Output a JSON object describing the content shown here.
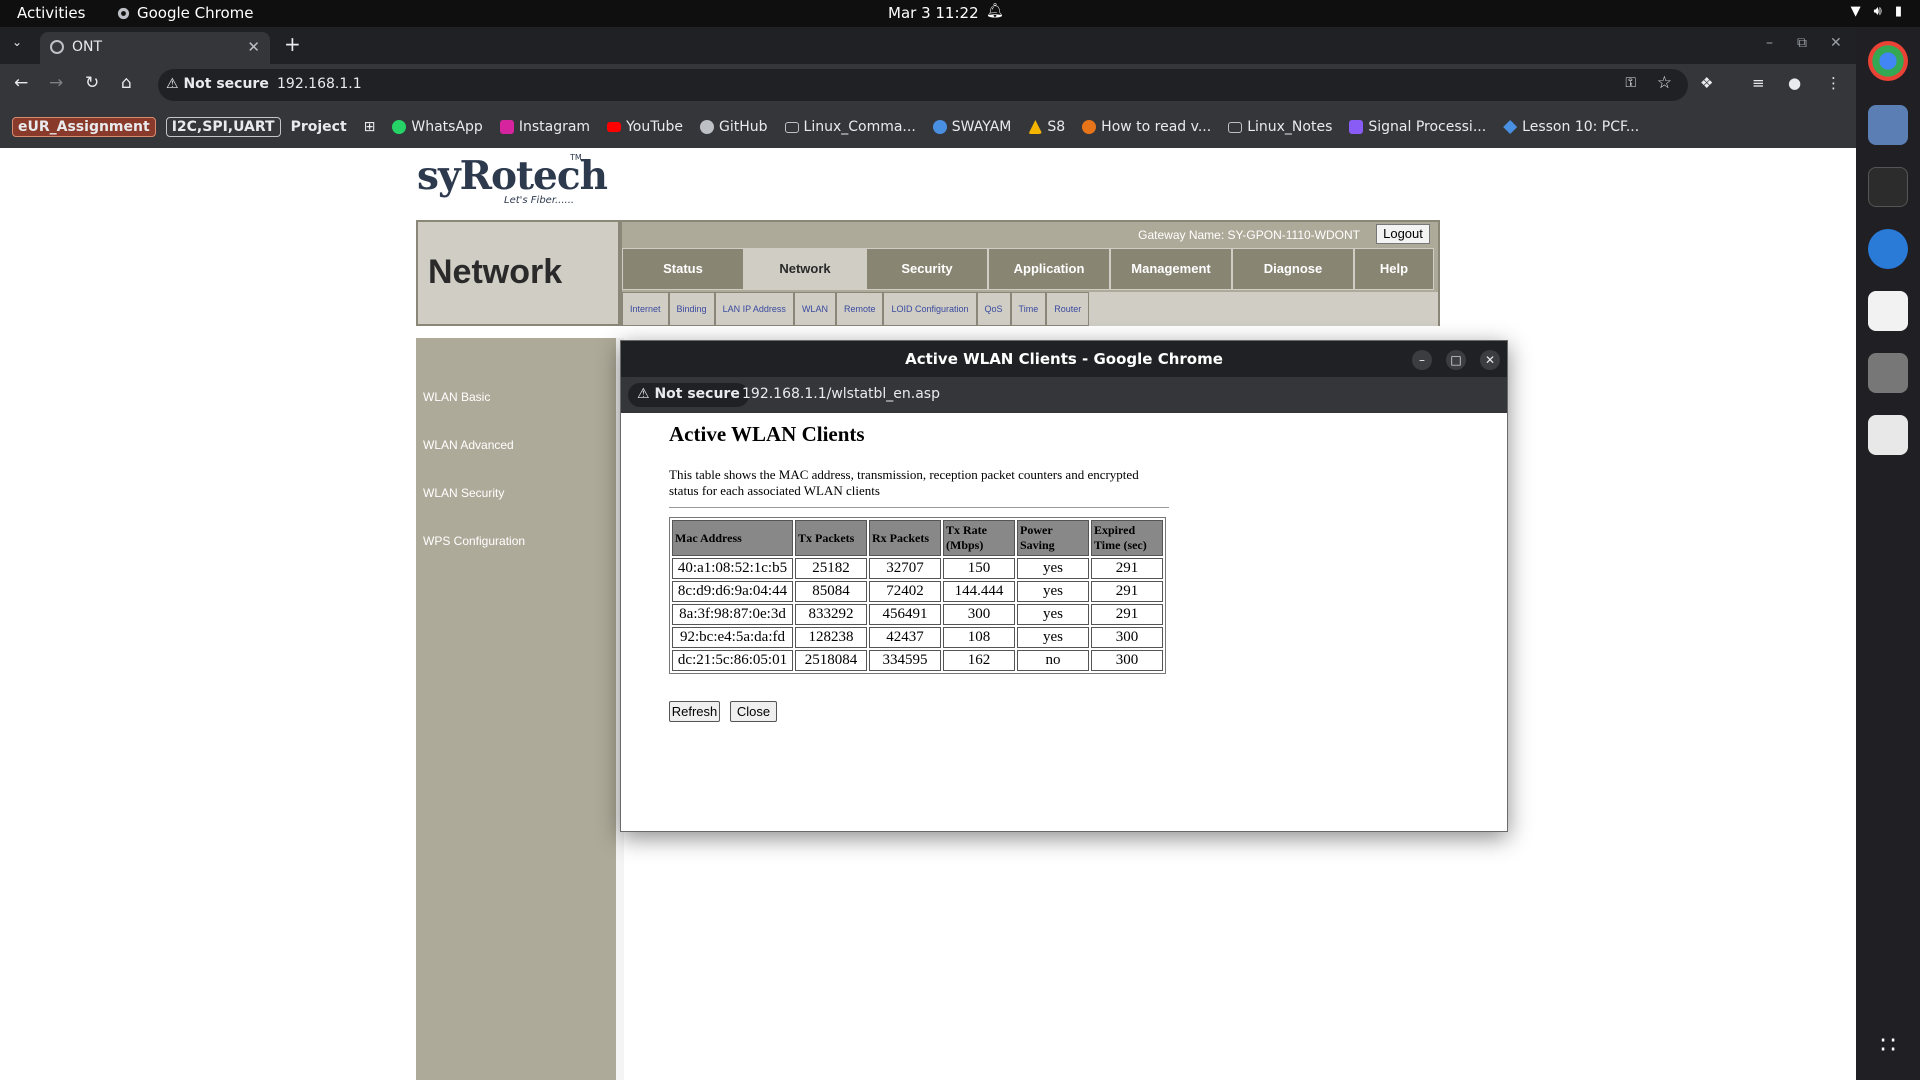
{
  "topbar": {
    "activities": "Activities",
    "app_name": "Google Chrome",
    "clock": "Mar 3  11:22"
  },
  "browser": {
    "tab_title": "ONT",
    "address_security": "Not secure",
    "address_url": "192.168.1.1",
    "bookmarks": [
      {
        "label": "eUR_Assignment",
        "kind": "tag-red"
      },
      {
        "label": "I2C,SPI,UART",
        "kind": "tag"
      },
      {
        "label": "Project",
        "kind": "plain-bold"
      },
      {
        "label": "WhatsApp",
        "icon": "whatsapp-icon",
        "color": "#25d366"
      },
      {
        "label": "Instagram",
        "icon": "instagram-icon",
        "color": "#d6249f"
      },
      {
        "label": "YouTube",
        "icon": "youtube-icon",
        "color": "#ff0000"
      },
      {
        "label": "GitHub",
        "icon": "github-icon",
        "color": "#bdc1c6"
      },
      {
        "label": "Linux_Comma...",
        "icon": "folder-icon",
        "color": "#bdc1c6"
      },
      {
        "label": "SWAYAM",
        "icon": "swayam-icon",
        "color": "#4a90e2"
      },
      {
        "label": "S8",
        "icon": "drive-icon",
        "color": "#f4b400"
      },
      {
        "label": "How to read v...",
        "icon": "site-icon",
        "color": "#e8741a"
      },
      {
        "label": "Linux_Notes",
        "icon": "folder-icon",
        "color": "#bdc1c6"
      },
      {
        "label": "Signal Processi...",
        "icon": "signal-icon",
        "color": "#8a5cf6"
      },
      {
        "label": "Lesson 10: PCF...",
        "icon": "lesson-icon",
        "color": "#4a90e2"
      }
    ]
  },
  "router": {
    "logo_tagline": "Let's Fiber......",
    "section_title": "Network",
    "gateway_label": "Gateway Name: SY-GPON-1110-WDONT",
    "logout": "Logout",
    "main_nav": [
      "Status",
      "Network",
      "Security",
      "Application",
      "Management",
      "Diagnose",
      "Help"
    ],
    "active_main": "Network",
    "sub_nav": [
      "Internet",
      "Binding",
      "LAN IP Address",
      "WLAN",
      "Remote",
      "LOID Configuration",
      "QoS",
      "Time",
      "Router"
    ],
    "left_nav": [
      "WLAN Basic",
      "WLAN Advanced",
      "WLAN Security",
      "WPS Configuration"
    ]
  },
  "popup": {
    "window_title": "Active WLAN Clients - Google Chrome",
    "security": "Not secure",
    "url": "192.168.1.1/wlstatbl_en.asp",
    "heading": "Active WLAN Clients",
    "description": "This table shows the MAC address, transmission, reception packet counters and encrypted status for each associated WLAN clients",
    "columns": [
      "Mac Address",
      "Tx Packets",
      "Rx Packets",
      "Tx Rate (Mbps)",
      "Power Saving",
      "Expired Time (sec)"
    ],
    "rows": [
      [
        "40:a1:08:52:1c:b5",
        "25182",
        "32707",
        "150",
        "yes",
        "291"
      ],
      [
        "8c:d9:d6:9a:04:44",
        "85084",
        "72402",
        "144.444",
        "yes",
        "291"
      ],
      [
        "8a:3f:98:87:0e:3d",
        "833292",
        "456491",
        "300",
        "yes",
        "291"
      ],
      [
        "92:bc:e4:5a:da:fd",
        "128238",
        "42437",
        "108",
        "yes",
        "300"
      ],
      [
        "dc:21:5c:86:05:01",
        "2518084",
        "334595",
        "162",
        "no",
        "300"
      ]
    ],
    "refresh": "Refresh",
    "close": "Close"
  }
}
